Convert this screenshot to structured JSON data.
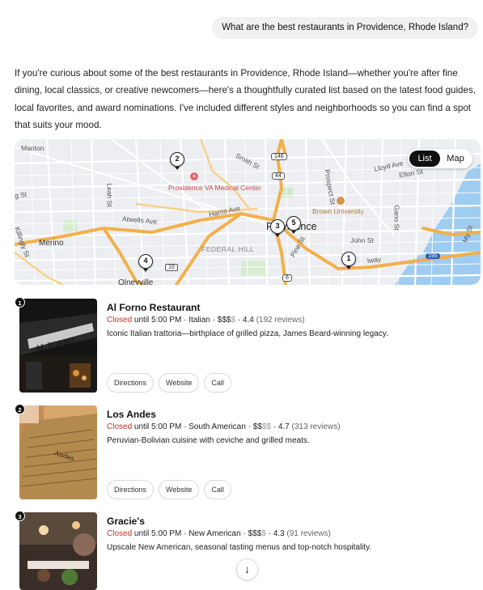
{
  "user_message": "What are the best restaurants in Providence, Rhode Island?",
  "intro": "If you're curious about some of the best restaurants in Providence, Rhode Island—whether you're after fine dining, local classics, or creative newcomers—here's a thoughtfully curated list based on the latest food guides, local favorites, and award nominations. I've included different styles and neighborhoods so you can find a spot that suits your mood.",
  "map": {
    "toggle": {
      "list": "List",
      "map": "Map",
      "active": "list"
    },
    "labels": {
      "manton": "Manton",
      "smith_st": "Smith St",
      "lloyd_ave": "Lloyd Ave",
      "elton_st": "Elton St",
      "prospect_st": "Prospect St",
      "lenah_st": "Leah St",
      "gano_st": "Gano St",
      "atwells_ave": "Atwells Ave",
      "harris_ave": "Harris Ave",
      "merino": "Merino",
      "killingly_st": "Killingly St",
      "federal_hill": "FEDERAL HILL",
      "providence": "Providence",
      "john_st": "John St",
      "pine_st": "Pine St",
      "my_st": "My St",
      "olneyville": "Olneyville",
      "va_center": "Providence VA Medical Center",
      "brown": "Brown University",
      "g_st": "g St",
      "way": "lway",
      "hwy_146": "146",
      "hwy_44": "44",
      "hwy_10": "10",
      "hwy_6": "6",
      "hwy_195": "195"
    },
    "markers": [
      "1",
      "2",
      "3",
      "4",
      "5"
    ]
  },
  "restaurants": [
    {
      "number": "1",
      "name": "Al Forno Restaurant",
      "status": "Closed",
      "hours": "until 5:00 PM",
      "cuisine": "Italian",
      "price_active": "$$$",
      "price_dim": "$",
      "rating": "4.4",
      "reviews": "(192 reviews)",
      "description": "Iconic Italian trattoria—birthplace of grilled pizza, James Beard-winning legacy.",
      "actions": {
        "directions": "Directions",
        "website": "Website",
        "call": "Call"
      }
    },
    {
      "number": "2",
      "name": "Los Andes",
      "status": "Closed",
      "hours": "until 5:00 PM",
      "cuisine": "South American",
      "price_active": "$$",
      "price_dim": "$$",
      "rating": "4.7",
      "reviews": "(313 reviews)",
      "description": "Peruvian-Bolivian cuisine with ceviche and grilled meats.",
      "actions": {
        "directions": "Directions",
        "website": "Website",
        "call": "Call"
      }
    },
    {
      "number": "3",
      "name": "Gracie's",
      "status": "Closed",
      "hours": "until 5:00 PM",
      "cuisine": "New American",
      "price_active": "$$$",
      "price_dim": "$",
      "rating": "4.3",
      "reviews": "(91 reviews)",
      "description": "Upscale New American, seasonal tasting menus and top-notch hospitality.",
      "actions": {
        "directions": "Directions",
        "website": "Website",
        "call": "Call"
      }
    }
  ],
  "scroll_icon": "arrow-down-icon"
}
